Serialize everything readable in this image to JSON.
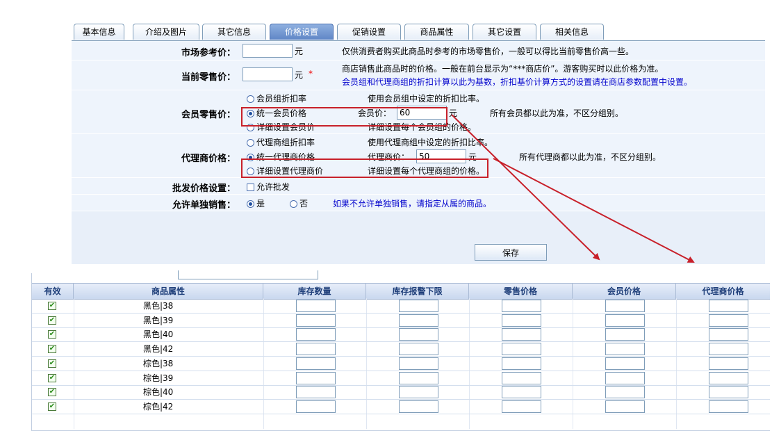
{
  "tabs": [
    {
      "label": "基本信息",
      "active": false
    },
    {
      "label": "介绍及图片",
      "active": false
    },
    {
      "label": "其它信息",
      "active": false
    },
    {
      "label": "价格设置",
      "active": true
    },
    {
      "label": "促销设置",
      "active": false
    },
    {
      "label": "商品属性",
      "active": false
    },
    {
      "label": "其它设置",
      "active": false
    },
    {
      "label": "相关信息",
      "active": false
    }
  ],
  "form": {
    "market_price": {
      "label": "市场参考价：",
      "value": "",
      "unit": "元",
      "note": "仅供消费者购买此商品时参考的市场零售价，一般可以得比当前零售价高一些。"
    },
    "retail_price": {
      "label": "当前零售价：",
      "value": "",
      "unit": "元",
      "required_mark": "*",
      "note1": "商店销售此商品时的价格。一般在前台显示为“***商店价”。游客购买时以此价格为准。",
      "note2": "会员组和代理商组的折扣计算以此为基数，折扣基价计算方式的设置请在商店参数配置中设置。"
    },
    "member_price": {
      "label": "会员零售价：",
      "opt1": "会员组折扣率",
      "opt1_desc": "使用会员组中设定的折扣比率。",
      "opt2": "统一会员价格",
      "opt2_field_label": "会员价：",
      "opt2_value": "60",
      "unit": "元",
      "opt2_desc": "所有会员都以此为准，不区分组别。",
      "opt3": "详细设置会员价",
      "opt3_desc": "详细设置每个会员组的价格。",
      "selected": 2
    },
    "agent_price": {
      "label": "代理商价格：",
      "opt1": "代理商组折扣率",
      "opt1_desc": "使用代理商组中设定的折扣比率。",
      "opt2": "统一代理商价格",
      "opt2_field_label": "代理商价：",
      "opt2_value": "50",
      "unit": "元",
      "opt2_desc": "所有代理商都以此为准，不区分组别。",
      "opt3": "详细设置代理商价",
      "opt3_desc": "详细设置每个代理商组的价格。",
      "selected": 2
    },
    "wholesale": {
      "label": "批发价格设置：",
      "checkbox_label": "允许批发",
      "checked": false
    },
    "single_sale": {
      "label": "允许单独销售：",
      "yes": "是",
      "no": "否",
      "selected": "yes",
      "note": "如果不允许单独销售，请指定从属的商品。"
    },
    "save_label": "保存"
  },
  "grid": {
    "headers": [
      "有效",
      "商品属性",
      "库存数量",
      "库存报警下限",
      "零售价格",
      "会员价格",
      "代理商价格"
    ],
    "rows": [
      {
        "attr": "黑色|38",
        "valid": true
      },
      {
        "attr": "黑色|39",
        "valid": true
      },
      {
        "attr": "黑色|40",
        "valid": true
      },
      {
        "attr": "黑色|42",
        "valid": true
      },
      {
        "attr": "棕色|38",
        "valid": true
      },
      {
        "attr": "棕色|39",
        "valid": true
      },
      {
        "attr": "棕色|40",
        "valid": true
      },
      {
        "attr": "棕色|42",
        "valid": true
      }
    ]
  },
  "colors": {
    "accent": "#c8202a",
    "row_bg": "#eef4fc",
    "link_blue": "#0000cc",
    "tab_active": "#5f86c6"
  }
}
